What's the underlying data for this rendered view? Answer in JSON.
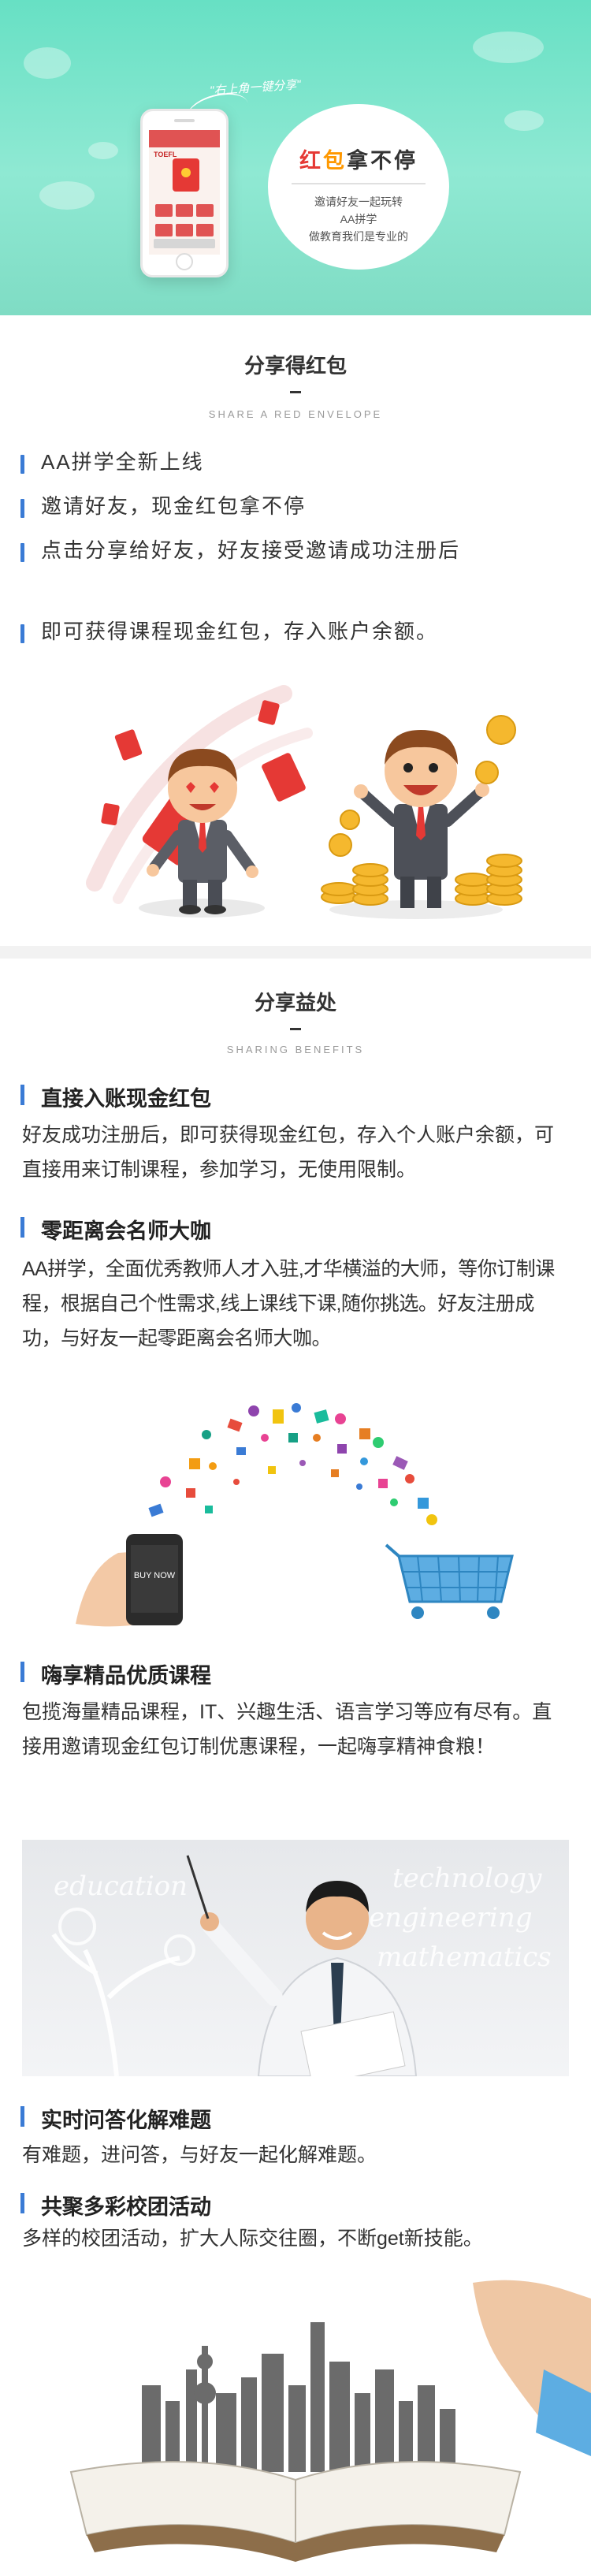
{
  "hero": {
    "quote": "\"右上角一键分享\"",
    "title_chars": [
      "红",
      "包",
      "拿",
      "不",
      "停"
    ],
    "title_colors": [
      "#e53935",
      "#ff9800",
      "#333333",
      "#333333",
      "#333333"
    ],
    "lines": [
      "邀请好友一起玩转",
      "AA拼学",
      "做教育我们是专业的"
    ],
    "phone_screen_text": "TOEFL"
  },
  "share_section": {
    "title": "分享得红包",
    "subtitle": "SHARE A RED ENVELOPE",
    "bullets": [
      "AA拼学全新上线",
      "邀请好友，现金红包拿不停",
      "点击分享给好友，好友接受邀请成功注册后",
      "即可获得课程现金红包，存入账户余额。"
    ]
  },
  "benefits_section": {
    "title": "分享益处",
    "subtitle": "SHARING BENEFITS",
    "items": [
      {
        "heading": "直接入账现金红包",
        "text": "好友成功注册后，即可获得现金红包，存入个人账户余额，可直接用来订制课程，参加学习，无使用限制。"
      },
      {
        "heading": "零距离会名师大咖",
        "text": "AA拼学，全面优秀教师人才入驻,才华横溢的大师，等你订制课程，根据自己个性需求,线上课线下课,随你挑选。好友注册成功，与好友一起零距离会名师大咖。"
      },
      {
        "heading": "嗨享精品优质课程",
        "text": "包揽海量精品课程，IT、兴趣生活、语言学习等应有尽有。直接用邀请现金红包订制优惠课程，一起嗨享精神食粮！"
      },
      {
        "heading": "实时问答化解难题",
        "text": "有难题，进问答，与好友一起化解难题。"
      },
      {
        "heading": "共聚多彩校团活动",
        "text": "多样的校团活动，扩大人际交往圈，不断get新技能。"
      }
    ]
  },
  "shopping_illustration": {
    "phone_text": "BUY NOW"
  },
  "teacher_board": {
    "board_words": [
      "education",
      "technology",
      "engineering",
      "mathematics"
    ]
  },
  "colors": {
    "hero_green": "#67e0c4",
    "accent_blue": "#3a7bd5",
    "red_envelope": "#e53935",
    "coin_gold": "#f5b82e"
  }
}
